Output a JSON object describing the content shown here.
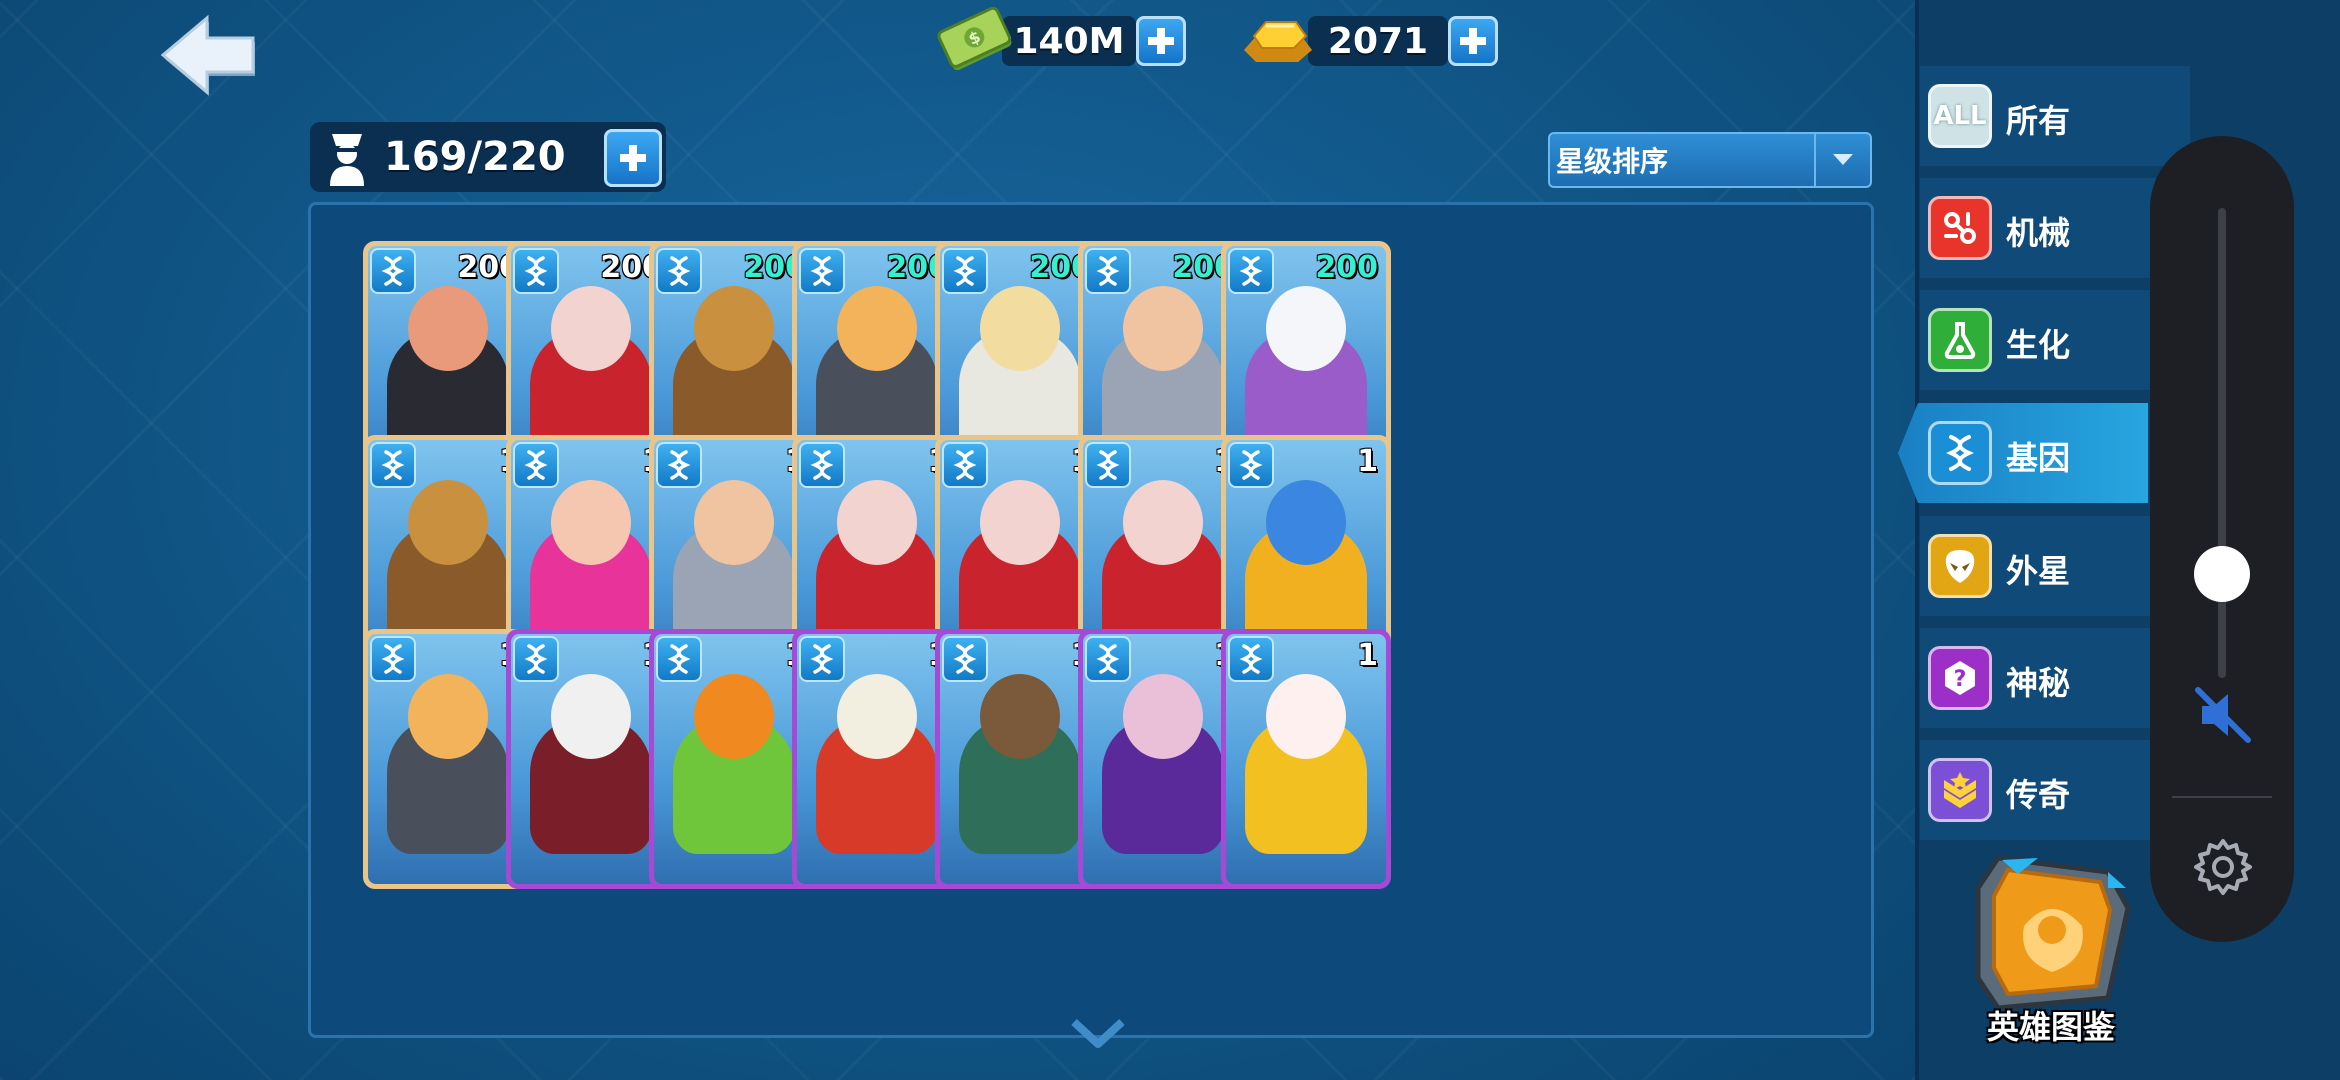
{
  "currency": {
    "cash": "140M",
    "gold": "2071"
  },
  "capacity": "169/220",
  "sort": {
    "label": "星级排序"
  },
  "cards": [
    {
      "level": "200",
      "stars": "★★★★",
      "star_color": "#ff7be0",
      "level_color": "#ffffff",
      "frame": "gold",
      "skin": "#e89a7a",
      "body": "#2a2a33"
    },
    {
      "level": "200",
      "stars": "★★★★",
      "star_color": "#ff7be0",
      "level_color": "#ffffff",
      "frame": "gold",
      "skin": "#f3d3d0",
      "body": "#c9242d"
    },
    {
      "level": "200",
      "stars": "★★★★★",
      "star_color": "#ffc21a",
      "level_color": "#35f0d0",
      "frame": "gold",
      "skin": "#c9903f",
      "body": "#8a5a2b"
    },
    {
      "level": "200",
      "stars": "★★★★★",
      "star_color": "#ffc21a",
      "level_color": "#35f0d0",
      "frame": "gold",
      "skin": "#f3b35a",
      "body": "#4a4f5c"
    },
    {
      "level": "200",
      "stars": "★★★★★",
      "star_color": "#ffc21a",
      "level_color": "#35f0d0",
      "frame": "gold",
      "skin": "#f3dca0",
      "body": "#e8e8e0"
    },
    {
      "level": "200",
      "stars": "★★★★★",
      "star_color": "#ffc21a",
      "level_color": "#35f0d0",
      "frame": "gold",
      "skin": "#f0c4a0",
      "body": "#9aa4b4"
    },
    {
      "level": "200",
      "stars": "★★★★★",
      "star_color": "#ffc21a",
      "level_color": "#35f0d0",
      "frame": "gold",
      "skin": "#f4f6fa",
      "body": "#9a5cc9"
    },
    {
      "level": "1",
      "stars": "★★★★★",
      "star_color": "#ffc21a",
      "level_color": "#ffffff",
      "frame": "gold",
      "skin": "#c9903f",
      "body": "#8a5a2b"
    },
    {
      "level": "1",
      "stars": "★★★★★",
      "star_color": "#ffc21a",
      "level_color": "#ffffff",
      "frame": "gold",
      "skin": "#f6c7b0",
      "body": "#e8349a"
    },
    {
      "level": "1",
      "stars": "★★★★★",
      "star_color": "#ffc21a",
      "level_color": "#ffffff",
      "frame": "gold",
      "skin": "#f0c4a0",
      "body": "#9aa4b4"
    },
    {
      "level": "1",
      "stars": "★★★★★",
      "star_color": "#ffc21a",
      "level_color": "#ffffff",
      "frame": "gold",
      "skin": "#f3d3d0",
      "body": "#c9242d"
    },
    {
      "level": "1",
      "stars": "★★★★★",
      "star_color": "#ffc21a",
      "level_color": "#ffffff",
      "frame": "gold",
      "skin": "#f3d3d0",
      "body": "#c9242d"
    },
    {
      "level": "1",
      "stars": "★★★★★",
      "star_color": "#ffc21a",
      "level_color": "#ffffff",
      "frame": "gold",
      "skin": "#f3d3d0",
      "body": "#c9242d"
    },
    {
      "level": "1",
      "stars": "★★★★★",
      "star_color": "#ffc21a",
      "level_color": "#ffffff",
      "frame": "gold",
      "skin": "#3a86e0",
      "body": "#f0b020"
    },
    {
      "level": "1",
      "stars": "",
      "star_color": "#ffc21a",
      "level_color": "#ffffff",
      "frame": "gold",
      "skin": "#f3b35a",
      "body": "#4a4f5c"
    },
    {
      "level": "1",
      "stars": "",
      "star_color": "#ffc21a",
      "level_color": "#ffffff",
      "frame": "purple",
      "skin": "#f0f0f0",
      "body": "#7a1f2a"
    },
    {
      "level": "1",
      "stars": "",
      "star_color": "#ffc21a",
      "level_color": "#ffffff",
      "frame": "purple",
      "skin": "#f08a20",
      "body": "#6fc63a"
    },
    {
      "level": "1",
      "stars": "",
      "star_color": "#ffc21a",
      "level_color": "#ffffff",
      "frame": "purple",
      "skin": "#f2eee0",
      "body": "#d83a2a"
    },
    {
      "level": "1",
      "stars": "",
      "star_color": "#ffc21a",
      "level_color": "#ffffff",
      "frame": "purple",
      "skin": "#7a5a3a",
      "body": "#2f6f5a"
    },
    {
      "level": "1",
      "stars": "",
      "star_color": "#ffc21a",
      "level_color": "#ffffff",
      "frame": "purple",
      "skin": "#e9c0d8",
      "body": "#5a2a9a"
    },
    {
      "level": "1",
      "stars": "",
      "star_color": "#ffc21a",
      "level_color": "#ffffff",
      "frame": "purple",
      "skin": "#fff0f0",
      "body": "#f2c020"
    }
  ],
  "categories": [
    {
      "name": "所有",
      "icon": "all-icon",
      "icon_text": "ALL",
      "color": "#cfe3e6"
    },
    {
      "name": "机械",
      "icon": "mech-icon",
      "color": "#e8342b"
    },
    {
      "name": "生化",
      "icon": "flask-icon",
      "color": "#2fae3a"
    },
    {
      "name": "基因",
      "icon": "dna-icon",
      "color": "#1b8fd6"
    },
    {
      "name": "外星",
      "icon": "alien-icon",
      "color": "#e2a514"
    },
    {
      "name": "神秘",
      "icon": "mystery-icon",
      "color": "#9d2fc9"
    },
    {
      "name": "传奇",
      "icon": "legend-icon",
      "color": "#7b4fd6"
    }
  ],
  "active_category": "基因",
  "handbook": {
    "label": "英雄图鉴"
  },
  "volume": {
    "level": 0.2,
    "muted": true
  }
}
